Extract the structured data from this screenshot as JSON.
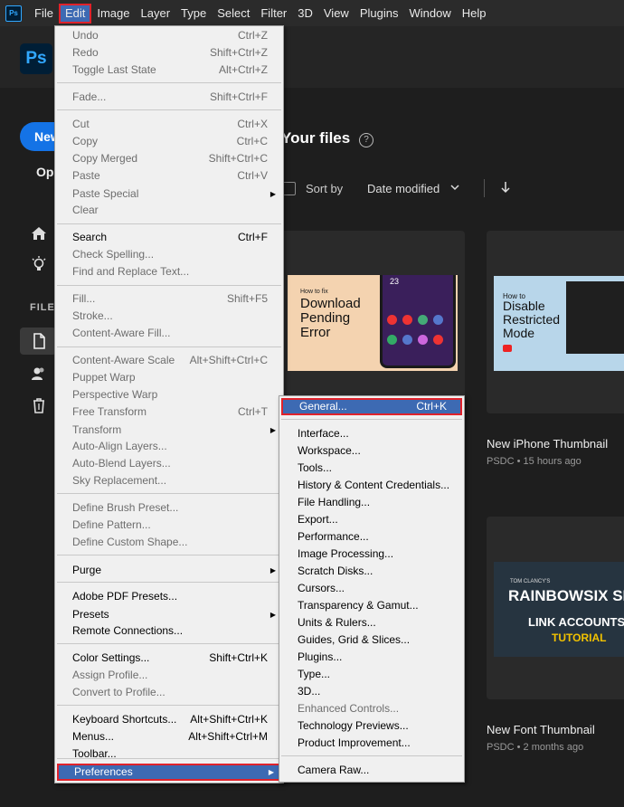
{
  "menubar": {
    "app_icon": "Ps",
    "items": [
      "File",
      "Edit",
      "Image",
      "Layer",
      "Type",
      "Select",
      "Filter",
      "3D",
      "View",
      "Plugins",
      "Window",
      "Help"
    ]
  },
  "home": {
    "app_logo": "Ps",
    "new_label": "New",
    "open_label": "Ope",
    "files_heading": "FILES",
    "your_files": "Your files",
    "sort_by": "Sort by",
    "sort_value": "Date modified"
  },
  "cards": [
    {
      "thumb_small": "How to fix",
      "thumb_big": "Download Pending Error",
      "time": "23"
    },
    {
      "thumb_lines": [
        "How to",
        "Disable",
        "Restricted",
        "Mode"
      ],
      "title": "New iPhone Thumbnail",
      "meta": "PSDC • 15 hours ago"
    },
    {
      "thumb_brand": "TOM CLANCY'S",
      "thumb_title": "RAINBOWSIX SIE",
      "thumb_line1": "LINK ACCOUNTS",
      "thumb_line2": "TUTORIAL",
      "title": "New Font Thumbnail",
      "meta": "PSDC • 2 months ago"
    }
  ],
  "edit_menu": {
    "items": [
      {
        "label": "Undo",
        "shortcut": "Ctrl+Z",
        "disabled": true
      },
      {
        "label": "Redo",
        "shortcut": "Shift+Ctrl+Z",
        "disabled": true
      },
      {
        "label": "Toggle Last State",
        "shortcut": "Alt+Ctrl+Z",
        "disabled": true
      },
      {
        "label": "Fade...",
        "shortcut": "Shift+Ctrl+F",
        "disabled": true
      },
      {
        "label": "Cut",
        "shortcut": "Ctrl+X",
        "disabled": true
      },
      {
        "label": "Copy",
        "shortcut": "Ctrl+C",
        "disabled": true
      },
      {
        "label": "Copy Merged",
        "shortcut": "Shift+Ctrl+C",
        "disabled": true
      },
      {
        "label": "Paste",
        "shortcut": "Ctrl+V",
        "disabled": true
      },
      {
        "label": "Paste Special",
        "shortcut": "",
        "disabled": true
      },
      {
        "label": "Clear",
        "shortcut": "",
        "disabled": true
      },
      {
        "label": "Search",
        "shortcut": "Ctrl+F",
        "disabled": false
      },
      {
        "label": "Check Spelling...",
        "shortcut": "",
        "disabled": true
      },
      {
        "label": "Find and Replace Text...",
        "shortcut": "",
        "disabled": true
      },
      {
        "label": "Fill...",
        "shortcut": "Shift+F5",
        "disabled": true
      },
      {
        "label": "Stroke...",
        "shortcut": "",
        "disabled": true
      },
      {
        "label": "Content-Aware Fill...",
        "shortcut": "",
        "disabled": true
      },
      {
        "label": "Content-Aware Scale",
        "shortcut": "Alt+Shift+Ctrl+C",
        "disabled": true
      },
      {
        "label": "Puppet Warp",
        "shortcut": "",
        "disabled": true
      },
      {
        "label": "Perspective Warp",
        "shortcut": "",
        "disabled": true
      },
      {
        "label": "Free Transform",
        "shortcut": "Ctrl+T",
        "disabled": true
      },
      {
        "label": "Transform",
        "shortcut": "",
        "disabled": true
      },
      {
        "label": "Auto-Align Layers...",
        "shortcut": "",
        "disabled": true
      },
      {
        "label": "Auto-Blend Layers...",
        "shortcut": "",
        "disabled": true
      },
      {
        "label": "Sky Replacement...",
        "shortcut": "",
        "disabled": true
      },
      {
        "label": "Define Brush Preset...",
        "shortcut": "",
        "disabled": true
      },
      {
        "label": "Define Pattern...",
        "shortcut": "",
        "disabled": true
      },
      {
        "label": "Define Custom Shape...",
        "shortcut": "",
        "disabled": true
      },
      {
        "label": "Purge",
        "shortcut": "",
        "disabled": false
      },
      {
        "label": "Adobe PDF Presets...",
        "shortcut": "",
        "disabled": false
      },
      {
        "label": "Presets",
        "shortcut": "",
        "disabled": false
      },
      {
        "label": "Remote Connections...",
        "shortcut": "",
        "disabled": false
      },
      {
        "label": "Color Settings...",
        "shortcut": "Shift+Ctrl+K",
        "disabled": false
      },
      {
        "label": "Assign Profile...",
        "shortcut": "",
        "disabled": true
      },
      {
        "label": "Convert to Profile...",
        "shortcut": "",
        "disabled": true
      },
      {
        "label": "Keyboard Shortcuts...",
        "shortcut": "Alt+Shift+Ctrl+K",
        "disabled": false
      },
      {
        "label": "Menus...",
        "shortcut": "Alt+Shift+Ctrl+M",
        "disabled": false
      },
      {
        "label": "Toolbar...",
        "shortcut": "",
        "disabled": false
      },
      {
        "label": "Preferences",
        "shortcut": "",
        "disabled": false
      }
    ]
  },
  "pref_menu": {
    "items": [
      {
        "label": "General...",
        "shortcut": "Ctrl+K",
        "disabled": false
      },
      {
        "label": "Interface...",
        "shortcut": "",
        "disabled": false
      },
      {
        "label": "Workspace...",
        "shortcut": "",
        "disabled": false
      },
      {
        "label": "Tools...",
        "shortcut": "",
        "disabled": false
      },
      {
        "label": "History & Content Credentials...",
        "shortcut": "",
        "disabled": false
      },
      {
        "label": "File Handling...",
        "shortcut": "",
        "disabled": false
      },
      {
        "label": "Export...",
        "shortcut": "",
        "disabled": false
      },
      {
        "label": "Performance...",
        "shortcut": "",
        "disabled": false
      },
      {
        "label": "Image Processing...",
        "shortcut": "",
        "disabled": false
      },
      {
        "label": "Scratch Disks...",
        "shortcut": "",
        "disabled": false
      },
      {
        "label": "Cursors...",
        "shortcut": "",
        "disabled": false
      },
      {
        "label": "Transparency & Gamut...",
        "shortcut": "",
        "disabled": false
      },
      {
        "label": "Units & Rulers...",
        "shortcut": "",
        "disabled": false
      },
      {
        "label": "Guides, Grid & Slices...",
        "shortcut": "",
        "disabled": false
      },
      {
        "label": "Plugins...",
        "shortcut": "",
        "disabled": false
      },
      {
        "label": "Type...",
        "shortcut": "",
        "disabled": false
      },
      {
        "label": "3D...",
        "shortcut": "",
        "disabled": false
      },
      {
        "label": "Enhanced Controls...",
        "shortcut": "",
        "disabled": true
      },
      {
        "label": "Technology Previews...",
        "shortcut": "",
        "disabled": false
      },
      {
        "label": "Product Improvement...",
        "shortcut": "",
        "disabled": false
      },
      {
        "label": "Camera Raw...",
        "shortcut": "",
        "disabled": false
      }
    ]
  },
  "colors": {
    "highlight": "#3d6ab3",
    "annotation_red": "#e0222b",
    "accent_blue": "#1473e6",
    "ps_blue": "#31a8ff"
  }
}
